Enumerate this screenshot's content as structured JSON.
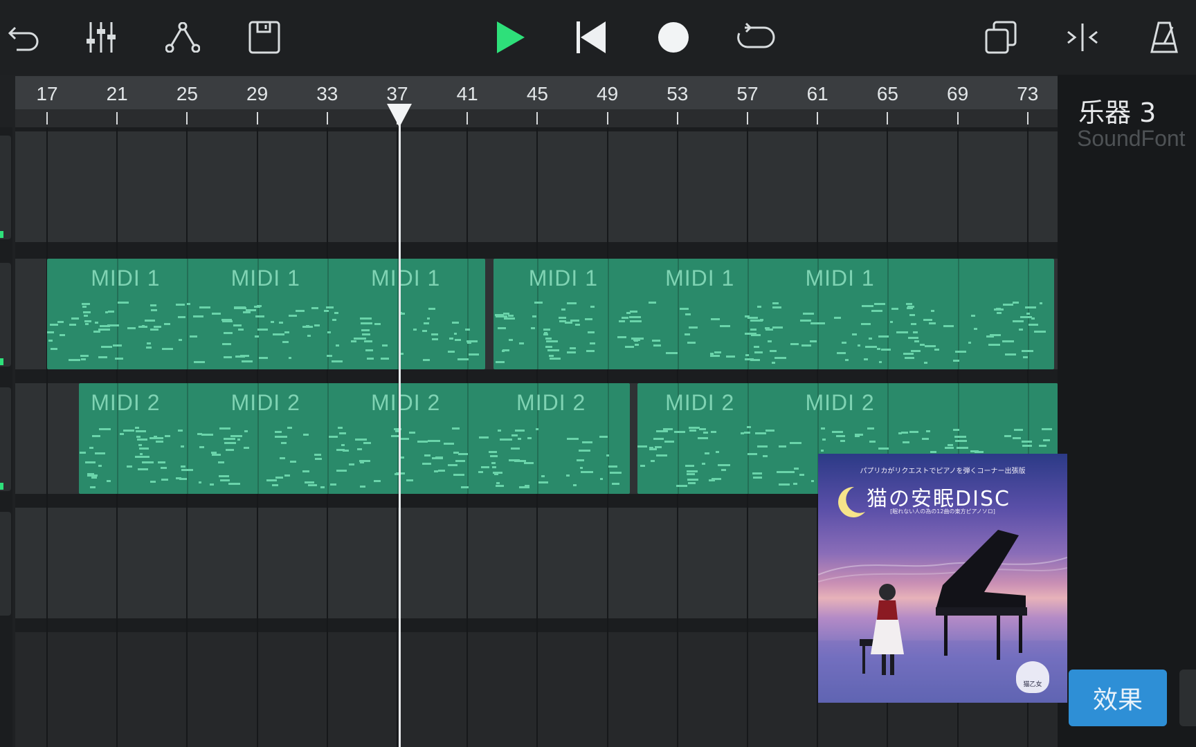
{
  "toolbar": {
    "left": [
      {
        "name": "undo-button",
        "icon": "undo-icon"
      },
      {
        "name": "mixer-button",
        "icon": "mixer-sliders-icon"
      },
      {
        "name": "automation-button",
        "icon": "automation-curve-icon"
      },
      {
        "name": "save-button",
        "icon": "save-floppy-icon"
      }
    ],
    "center": [
      {
        "name": "play-button",
        "icon": "play-icon",
        "color": "#2ee07a"
      },
      {
        "name": "rewind-to-start-button",
        "icon": "skip-back-icon"
      },
      {
        "name": "record-button",
        "icon": "record-icon"
      },
      {
        "name": "loop-button",
        "icon": "loop-icon"
      }
    ],
    "right": [
      {
        "name": "duplicate-button",
        "icon": "duplicate-icon"
      },
      {
        "name": "split-button",
        "icon": "split-icon"
      },
      {
        "name": "metronome-button",
        "icon": "metronome-icon"
      }
    ]
  },
  "ruler": {
    "bars": [
      "17",
      "21",
      "25",
      "29",
      "33",
      "37",
      "41",
      "45",
      "49",
      "53",
      "57",
      "61",
      "65",
      "69",
      "73"
    ]
  },
  "playhead": {
    "bar": 37.1
  },
  "tracks": [
    {
      "name": "track-1",
      "regions": []
    },
    {
      "name": "track-2",
      "regions": [
        {
          "label": "MIDI 1",
          "start": 17,
          "end": 42
        },
        {
          "label": "MIDI 1",
          "start": 42.5,
          "end": 74.5
        }
      ],
      "sublabels": [
        {
          "label": "MIDI 1",
          "bar": 19.5
        },
        {
          "label": "MIDI 1",
          "bar": 27.5
        },
        {
          "label": "MIDI 1",
          "bar": 35.5
        },
        {
          "label": "MIDI 1",
          "bar": 44.5
        },
        {
          "label": "MIDI 1",
          "bar": 52.3
        },
        {
          "label": "MIDI 1",
          "bar": 60.3
        }
      ]
    },
    {
      "name": "track-3",
      "regions": [
        {
          "label": "MIDI 2",
          "start": 18.8,
          "end": 50.3
        },
        {
          "label": "MIDI 2",
          "start": 50.7,
          "end": 76
        }
      ],
      "sublabels": [
        {
          "label": "MIDI 2",
          "bar": 19.5
        },
        {
          "label": "MIDI 2",
          "bar": 27.5
        },
        {
          "label": "MIDI 2",
          "bar": 35.5
        },
        {
          "label": "MIDI 2",
          "bar": 43.8
        },
        {
          "label": "MIDI 2",
          "bar": 52.3
        },
        {
          "label": "MIDI 2",
          "bar": 60.3
        }
      ]
    },
    {
      "name": "track-4",
      "regions": []
    }
  ],
  "instrument_panel": {
    "name": "乐器 3",
    "type": "SoundFont",
    "effects_button": "效果",
    "accent": "#2e8fd6"
  },
  "album_cover": {
    "top_line": "パプリカがリクエストでピアノを弾くコーナー出張版",
    "title": "猫の安眠DISC",
    "subtitle": "[眠れない人の為の12曲の東方ピアノソロ]",
    "logo": "猫乙女"
  },
  "colors": {
    "region": "#2a8a6a",
    "region_label": "#7fd3b3",
    "note": "#6ad4aa",
    "play": "#2ee07a"
  }
}
